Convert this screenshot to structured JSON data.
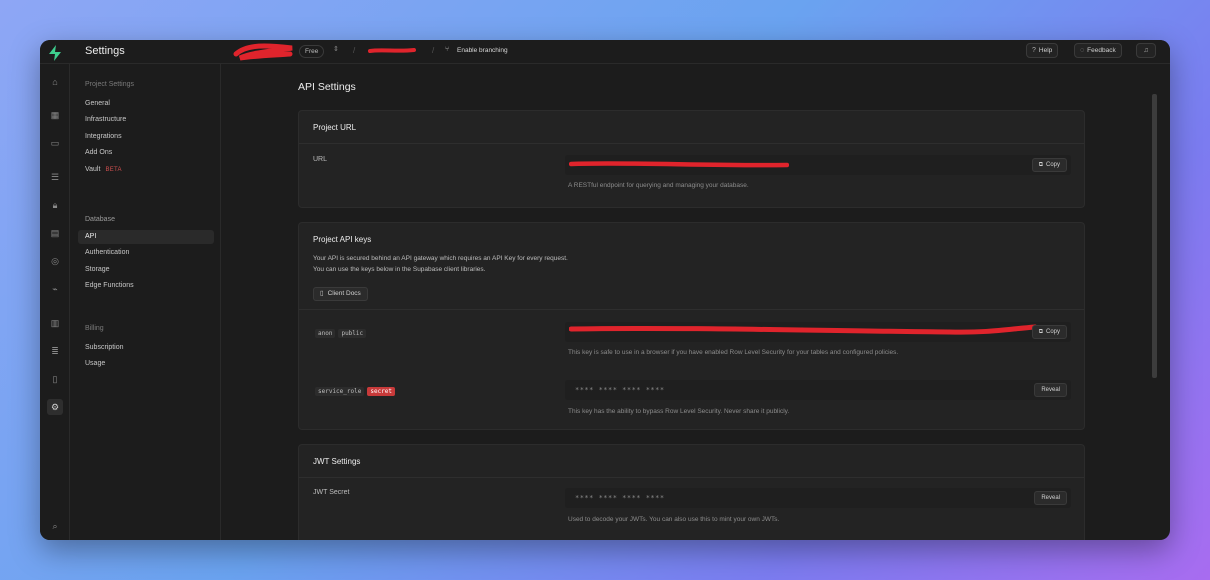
{
  "topbar": {
    "title": "Settings",
    "plan": "Free",
    "branching_label": "Enable branching",
    "help_label": "Help",
    "feedback_label": "Feedback"
  },
  "rail": {
    "icons": [
      "home-icon",
      "table-editor-icon",
      "sql-editor-icon",
      "database-icon",
      "auth-icon",
      "storage-icon",
      "realtime-icon",
      "edge-functions-icon",
      "reports-icon",
      "logs-icon",
      "docs-icon",
      "settings-icon",
      "search-icon"
    ]
  },
  "sidebar": {
    "project_settings_heading": "Project Settings",
    "project_items": [
      "General",
      "Infrastructure",
      "Integrations",
      "Add Ons",
      "Vault"
    ],
    "vault_badge": "BETA",
    "database_heading": "Database",
    "config_items": [
      "API",
      "Authentication",
      "Storage",
      "Edge Functions"
    ],
    "billing_heading": "Billing",
    "billing_items": [
      "Subscription",
      "Usage"
    ]
  },
  "main": {
    "page_title": "API Settings",
    "project_url": {
      "title": "Project URL",
      "label": "URL",
      "copy_label": "Copy",
      "help": "A RESTful endpoint for querying and managing your database."
    },
    "api_keys": {
      "title": "Project API keys",
      "desc_line1": "Your API is secured behind an API gateway which requires an API Key for every request.",
      "desc_line2": "You can use the keys below in the Supabase client libraries.",
      "docs_button": "Client Docs",
      "anon_tags": [
        "anon",
        "public"
      ],
      "anon_copy": "Copy",
      "anon_help": "This key is safe to use in a browser if you have enabled Row Level Security for your tables and configured policies.",
      "service_tags": [
        "service_role",
        "secret"
      ],
      "service_masked": "**** **** **** ****",
      "service_reveal": "Reveal",
      "service_help": "This key has the ability to bypass Row Level Security. Never share it publicly."
    },
    "jwt": {
      "title": "JWT Settings",
      "label": "JWT Secret",
      "masked": "**** **** **** ****",
      "reveal": "Reveal",
      "help": "Used to decode your JWTs. You can also use this to mint your own JWTs."
    }
  },
  "colors": {
    "accent": "#3ecf8e",
    "secret_badge": "#c83a3a",
    "redaction": "#e0242c"
  }
}
